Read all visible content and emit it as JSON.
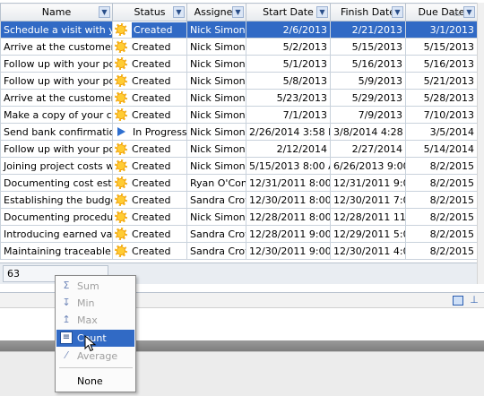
{
  "columns": [
    {
      "label": "Name",
      "filter": true,
      "sort": ""
    },
    {
      "label": "Status",
      "filter": true,
      "sort": ""
    },
    {
      "label": "Assigned",
      "filter": true,
      "sort": ""
    },
    {
      "label": "Start Date",
      "filter": true,
      "sort": ""
    },
    {
      "label": "Finish Date",
      "filter": true,
      "sort": ""
    },
    {
      "label": "Due Date",
      "filter": true,
      "sort": "△"
    }
  ],
  "rows": [
    {
      "name": "Schedule a visit with you",
      "status": "Created",
      "status_icon": "sun-icon",
      "assigned": "Nick Simons",
      "start": "2/6/2013",
      "finish": "2/21/2013",
      "due": "3/1/2013",
      "selected": true
    },
    {
      "name": "Arrive at the customer's",
      "status": "Created",
      "status_icon": "sun-icon",
      "assigned": "Nick Simons",
      "start": "5/2/2013",
      "finish": "5/15/2013",
      "due": "5/15/2013"
    },
    {
      "name": "Follow up with your pote",
      "status": "Created",
      "status_icon": "sun-icon",
      "assigned": "Nick Simons",
      "start": "5/1/2013",
      "finish": "5/16/2013",
      "due": "5/16/2013"
    },
    {
      "name": "Follow up with your pote",
      "status": "Created",
      "status_icon": "sun-icon",
      "assigned": "Nick Simons",
      "start": "5/8/2013",
      "finish": "5/9/2013",
      "due": "5/21/2013"
    },
    {
      "name": "Arrive at the customer's",
      "status": "Created",
      "status_icon": "sun-icon",
      "assigned": "Nick Simons",
      "start": "5/23/2013",
      "finish": "5/29/2013",
      "due": "5/28/2013"
    },
    {
      "name": "Make a copy of your cust",
      "status": "Created",
      "status_icon": "sun-icon",
      "assigned": "Nick Simons",
      "start": "7/1/2013",
      "finish": "7/9/2013",
      "due": "7/10/2013"
    },
    {
      "name": "Send bank confirmation",
      "status": "In Progress",
      "status_icon": "play-icon",
      "assigned": "Nick Simons",
      "start": "2/26/2014 3:58 P",
      "finish": "3/8/2014 4:28 PM",
      "due": "3/5/2014"
    },
    {
      "name": "Follow up with your pote",
      "status": "Created",
      "status_icon": "sun-icon",
      "assigned": "Nick Simons",
      "start": "2/12/2014",
      "finish": "2/27/2014",
      "due": "5/14/2014"
    },
    {
      "name": "Joining project costs with",
      "status": "Created",
      "status_icon": "sun-icon",
      "assigned": "Nick Simons",
      "start": "5/15/2013 8:00 A",
      "finish": "6/26/2013 9:00 A",
      "due": "8/2/2015"
    },
    {
      "name": "Documenting cost estima",
      "status": "Created",
      "status_icon": "sun-icon",
      "assigned": "Ryan O'Conn",
      "start": "12/31/2011 8:00",
      "finish": "12/31/2011 9:00",
      "due": "8/2/2015"
    },
    {
      "name": "Establishing the budget f",
      "status": "Created",
      "status_icon": "sun-icon",
      "assigned": "Sandra Crow",
      "start": "12/30/2011 8:00",
      "finish": "12/30/2011 7:00",
      "due": "8/2/2015"
    },
    {
      "name": "Documenting procedures",
      "status": "Created",
      "status_icon": "sun-icon",
      "assigned": "Nick Simons",
      "start": "12/28/2011 8:00",
      "finish": "12/28/2011 11:0",
      "due": "8/2/2015"
    },
    {
      "name": "Introducing earned value",
      "status": "Created",
      "status_icon": "sun-icon",
      "assigned": "Sandra Crow",
      "start": "12/28/2011 9:00",
      "finish": "12/29/2011 5:00",
      "due": "8/2/2015"
    },
    {
      "name": "Maintaining traceable pla",
      "status": "Created",
      "status_icon": "sun-icon",
      "assigned": "Sandra Crow",
      "start": "12/30/2011 9:00",
      "finish": "12/30/2011 4:00",
      "due": "8/2/2015"
    }
  ],
  "footer": {
    "summary_value": "63"
  },
  "summary_menu": {
    "items": [
      {
        "label": "Sum",
        "icon": "sigma-icon",
        "state": "disabled"
      },
      {
        "label": "Min",
        "icon": "min-icon",
        "state": "disabled"
      },
      {
        "label": "Max",
        "icon": "max-icon",
        "state": "disabled"
      },
      {
        "label": "Count",
        "icon": "count-icon",
        "state": "active"
      },
      {
        "label": "Average",
        "icon": "average-icon",
        "state": "disabled"
      },
      {
        "label": "None",
        "icon": "",
        "state": "enabled"
      }
    ]
  },
  "colors": {
    "selection": "#316ac5",
    "grid_line": "#c9d2dc",
    "header_bg": "#e7eaee"
  }
}
